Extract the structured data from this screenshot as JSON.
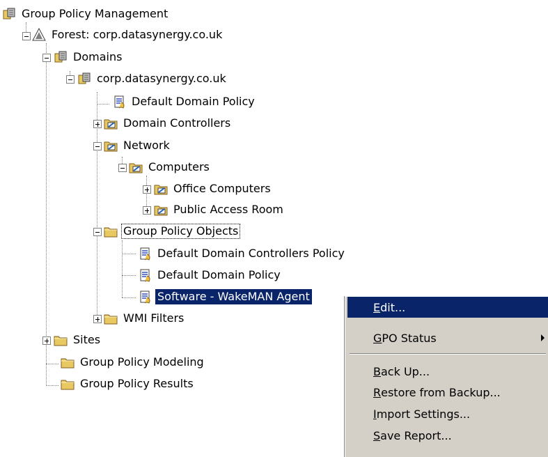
{
  "tree": {
    "root": "Group Policy Management",
    "forest": "Forest: corp.datasynergy.co.uk",
    "domains": "Domains",
    "domain": "corp.datasynergy.co.uk",
    "default_domain_policy_link": "Default Domain Policy",
    "domain_controllers": "Domain Controllers",
    "network": "Network",
    "computers": "Computers",
    "office_computers": "Office Computers",
    "public_access_room": "Public Access Room",
    "group_policy_objects": "Group Policy Objects",
    "gpo_default_dc_policy": "Default Domain Controllers Policy",
    "gpo_default_domain_policy": "Default Domain Policy",
    "gpo_software_wakeman": "Software - WakeMAN Agent",
    "wmi_filters": "WMI Filters",
    "sites": "Sites",
    "gp_modeling": "Group Policy Modeling",
    "gp_results": "Group Policy Results"
  },
  "context_menu": {
    "edit": {
      "key": "E",
      "rest": "dit..."
    },
    "gpo_status": {
      "key": "G",
      "rest": "PO Status"
    },
    "back_up": {
      "key": "B",
      "rest": "ack Up..."
    },
    "restore": {
      "key": "R",
      "rest": "estore from Backup..."
    },
    "import": {
      "key": "I",
      "rest": "mport Settings..."
    },
    "save_report": {
      "key": "S",
      "rest": "ave Report..."
    }
  },
  "colors": {
    "selection": "#0a246a",
    "menu_bg": "#d4d0c8"
  }
}
